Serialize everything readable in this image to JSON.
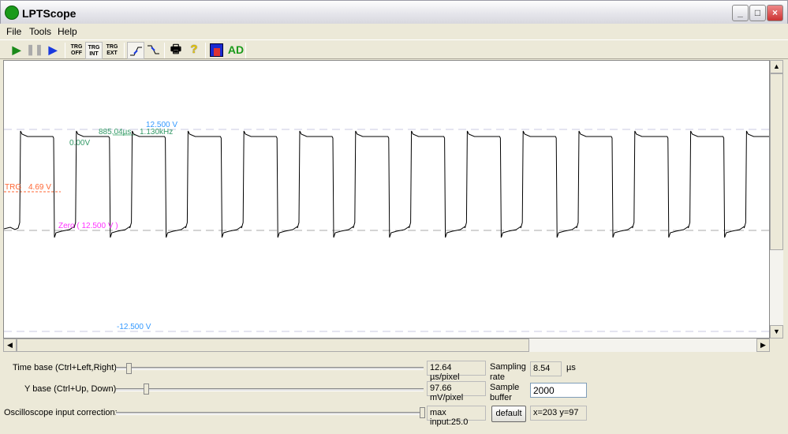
{
  "window": {
    "title": "LPTScope",
    "minimize": "_",
    "maximize": "□",
    "close": "×"
  },
  "menu": [
    "File",
    "Tools",
    "Help"
  ],
  "toolbar": {
    "trg_off": "TRG OFF",
    "trg_int": "TRG INT",
    "trg_ext": "TRG EXT",
    "ad": "AD",
    "icons": [
      "play-icon",
      "pause-icon",
      "step-icon",
      "rising-edge-icon",
      "falling-edge-icon",
      "printer-icon",
      "help-icon",
      "save-icon"
    ]
  },
  "scope": {
    "top_label": "12.500 V",
    "bottom_label": "-12.500 V",
    "period": "885.04µs",
    "frequency": "1.130kHz",
    "cursor_voltage": "0.00V",
    "trigger_label": "TRG",
    "trigger_value": "4.69 V",
    "zero_label": "Zero ( 12.500 V )",
    "colors": {
      "top": "#3399ff",
      "measure": "#339966",
      "trigger": "#ff6633",
      "zero": "#ff33ff",
      "trace": "#000000"
    }
  },
  "controls": {
    "time_base": {
      "label": "Time base (Ctrl+Left,Right)",
      "value": "12.64 µs/pixel"
    },
    "y_base": {
      "label": "Y base (Ctrl+Up, Down)",
      "value": "97.66 mV/pixel"
    },
    "correction": {
      "label": "Oscilloscope input correction:",
      "value": "max input:25.0"
    },
    "sampling_rate": {
      "label": "Sampling rate",
      "value": "8.54",
      "unit": "µs"
    },
    "sample_buffer": {
      "label": "Sample buffer",
      "value": "2000"
    },
    "default_button": "default",
    "coords": "x=203  y=97"
  }
}
